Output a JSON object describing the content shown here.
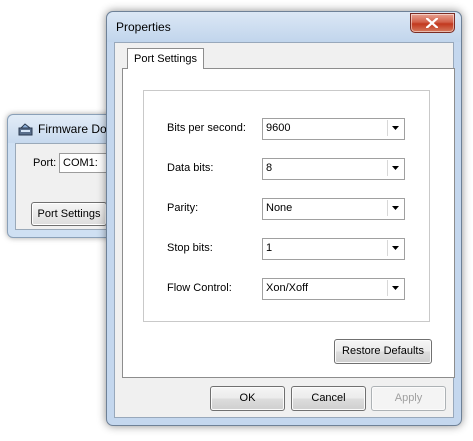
{
  "background_window": {
    "title": "Firmware Dov",
    "port_label": "Port:",
    "port_value": "COM1:",
    "port_settings_button": "Port Settings"
  },
  "dialog": {
    "title": "Properties",
    "tab_label": "Port Settings",
    "fields": [
      {
        "label": "Bits per second:",
        "value": "9600"
      },
      {
        "label": "Data bits:",
        "value": "8"
      },
      {
        "label": "Parity:",
        "value": "None"
      },
      {
        "label": "Stop bits:",
        "value": "1"
      },
      {
        "label": "Flow Control:",
        "value": "Xon/Xoff"
      }
    ],
    "restore_defaults_button": "Restore Defaults",
    "ok_button": "OK",
    "cancel_button": "Cancel",
    "apply_button": "Apply"
  },
  "colors": {
    "frame": "#c4d7ee",
    "close_button": "#c2381e",
    "client_bg": "#f0f0f0"
  },
  "icons": {
    "app_icon": "firmware-app-icon",
    "close": "close-icon",
    "dropdown": "dropdown-arrow-icon"
  }
}
